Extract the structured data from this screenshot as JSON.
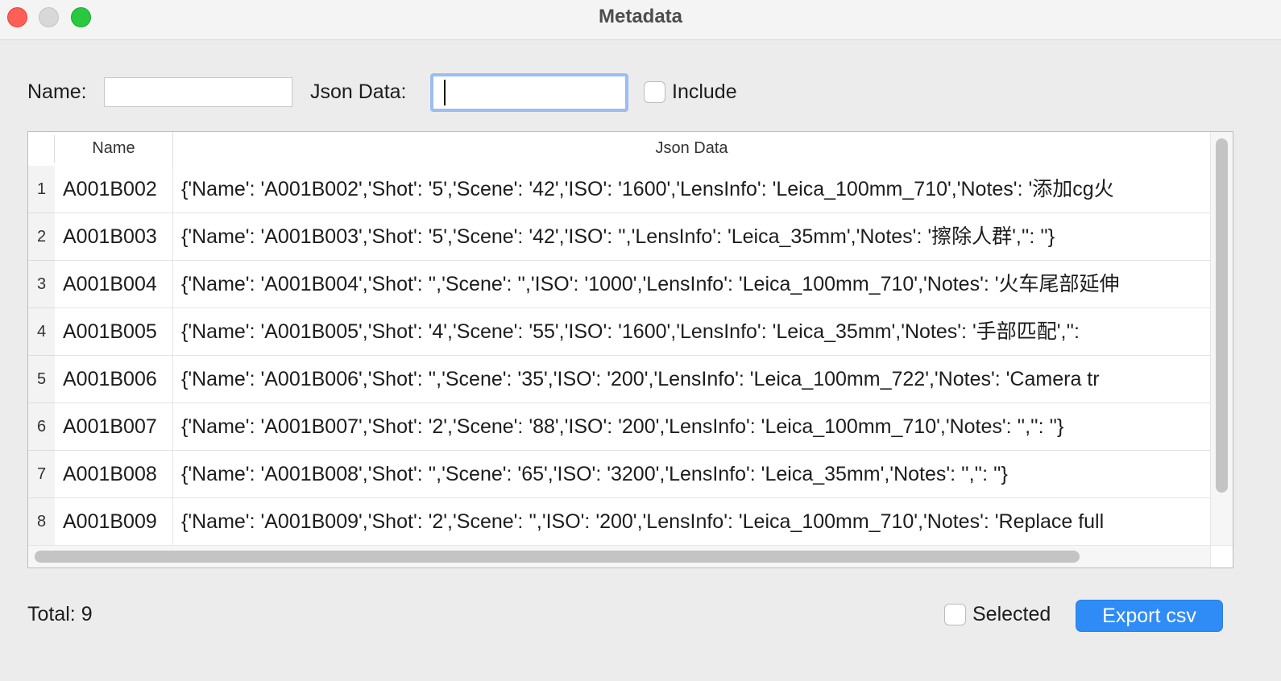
{
  "window": {
    "title": "Metadata"
  },
  "filters": {
    "name_label": "Name:",
    "name_value": "",
    "json_label": "Json Data:",
    "json_value": "",
    "include_label": "Include",
    "include_checked": false
  },
  "table": {
    "columns": [
      "Name",
      "Json Data"
    ],
    "rows": [
      {
        "num": "1",
        "name": "A001B002",
        "json": "{'Name': 'A001B002','Shot': '5','Scene': '42','ISO': '1600','LensInfo': 'Leica_100mm_710','Notes': '添加cg火"
      },
      {
        "num": "2",
        "name": "A001B003",
        "json": "{'Name': 'A001B003','Shot': '5','Scene': '42','ISO': '','LensInfo': 'Leica_35mm','Notes': '擦除人群','': ''}"
      },
      {
        "num": "3",
        "name": "A001B004",
        "json": "{'Name': 'A001B004','Shot': '','Scene': '','ISO': '1000','LensInfo': 'Leica_100mm_710','Notes': '火车尾部延伸"
      },
      {
        "num": "4",
        "name": "A001B005",
        "json": "{'Name': 'A001B005','Shot': '4','Scene': '55','ISO': '1600','LensInfo': 'Leica_35mm','Notes': '手部匹配','': "
      },
      {
        "num": "5",
        "name": "A001B006",
        "json": "{'Name': 'A001B006','Shot': '','Scene': '35','ISO': '200','LensInfo': 'Leica_100mm_722','Notes': 'Camera tr"
      },
      {
        "num": "6",
        "name": "A001B007",
        "json": "{'Name': 'A001B007','Shot': '2','Scene': '88','ISO': '200','LensInfo': 'Leica_100mm_710','Notes': '','': ''}"
      },
      {
        "num": "7",
        "name": "A001B008",
        "json": "{'Name': 'A001B008','Shot': '','Scene': '65','ISO': '3200','LensInfo': 'Leica_35mm','Notes': '','': ''}"
      },
      {
        "num": "8",
        "name": "A001B009",
        "json": "{'Name': 'A001B009','Shot': '2','Scene': '','ISO': '200','LensInfo': 'Leica_100mm_710','Notes': 'Replace full"
      }
    ]
  },
  "footer": {
    "total": "Total: 9",
    "selected_label": "Selected",
    "selected_checked": false,
    "export_label": "Export csv"
  },
  "colors": {
    "accent": "#2f8bf6",
    "focus_ring": "#9bbdf2",
    "close": "#fe5f57",
    "maximize": "#28c840"
  }
}
